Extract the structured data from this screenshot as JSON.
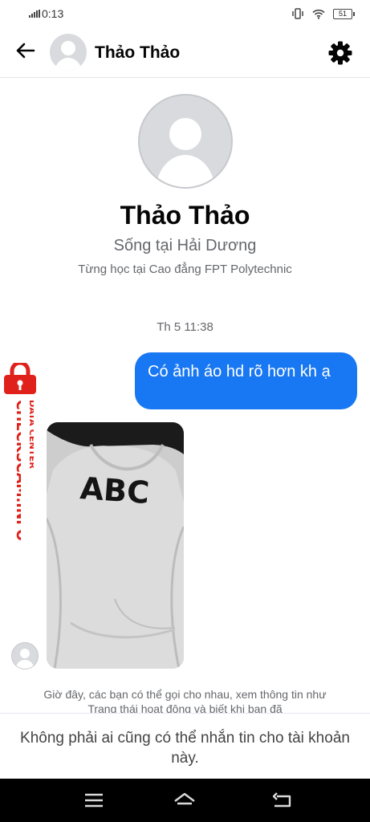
{
  "status_bar": {
    "time": "0:13",
    "battery": "51"
  },
  "header": {
    "contact_name": "Thảo Thảo"
  },
  "profile": {
    "name": "Thảo Thảo",
    "location": "Sống tại Hải Dương",
    "education": "Từng học tại Cao đẳng FPT Polytechnic"
  },
  "conversation": {
    "timestamp": "Th 5 11:38",
    "outgoing_message": "Có ảnh áo hd rõ hơn kh ạ",
    "photo_print_text": "ABC",
    "system_note": "Giờ đây, các bạn có thể gọi cho nhau, xem thông tin như Trạng thái hoạt động và biết khi bạn đã"
  },
  "footer": {
    "notice": "Không phải ai cũng có thể nhắn tin cho tài khoản này."
  },
  "watermark": {
    "main": "CHECKSCAM.INFO",
    "sub": "DATA CENTER"
  },
  "colors": {
    "accent": "#1877f2",
    "watermark": "#e0211b"
  }
}
